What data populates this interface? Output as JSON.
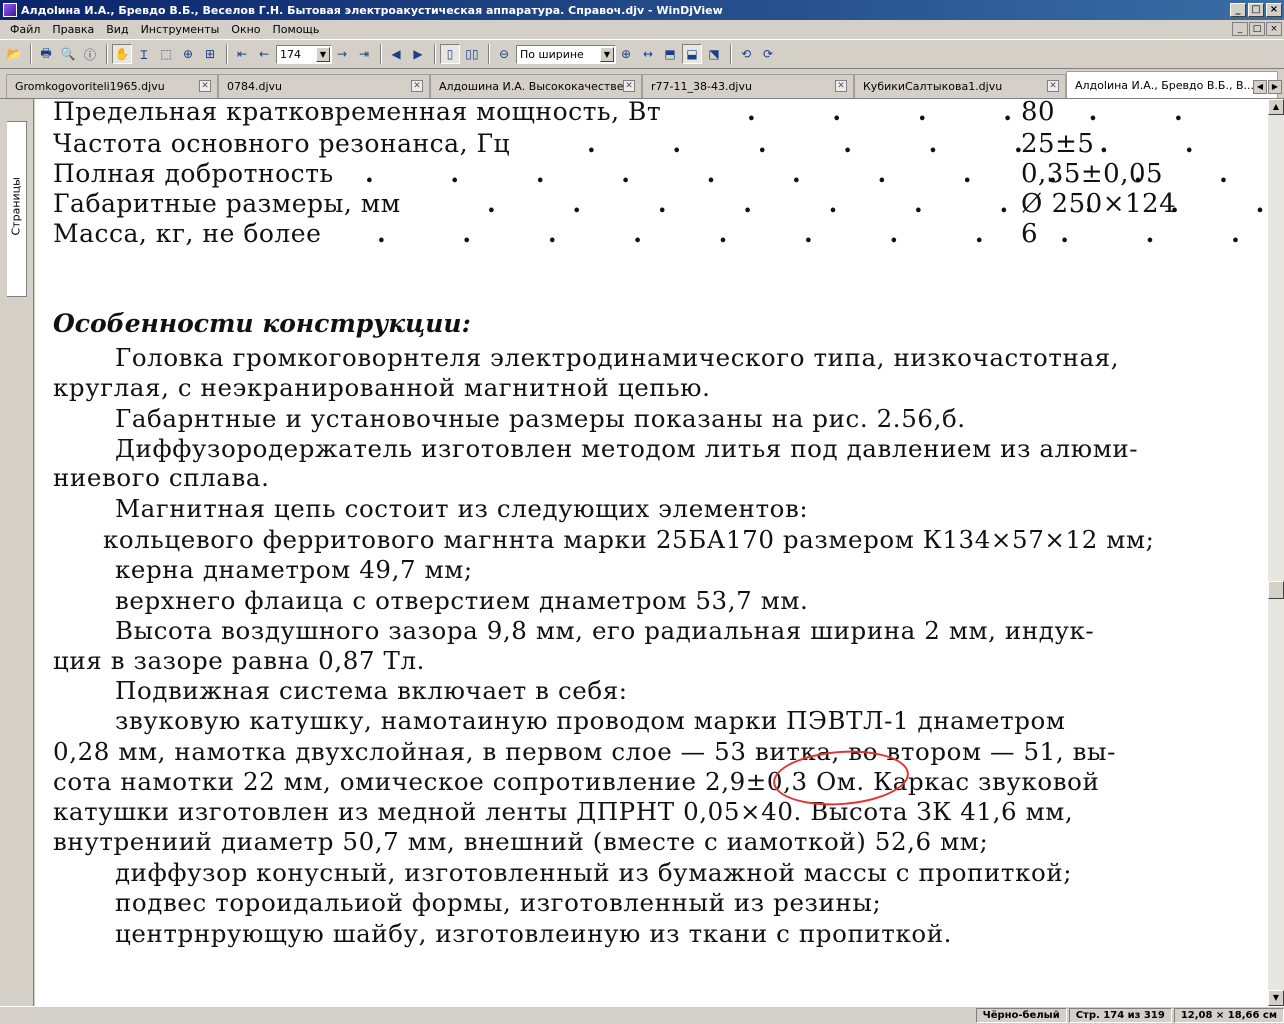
{
  "window": {
    "title": "Алдоlина И.А., Бревдо В.Б., Веселов Г.Н. Бытовая электроакустическая аппаратура. Справоч.djv - WinDjView",
    "controls": [
      "_",
      "□",
      "×"
    ]
  },
  "menu": {
    "items": [
      "Файл",
      "Правка",
      "Вид",
      "Инструменты",
      "Окно",
      "Помощь"
    ],
    "right_controls": [
      "_",
      "□",
      "×"
    ]
  },
  "toolbar": {
    "page_number": "174",
    "zoom_mode": "По ширине"
  },
  "tabs": [
    {
      "label": "Gromkogovoriteli1965.djvu",
      "active": false
    },
    {
      "label": "0784.djvu",
      "active": false
    },
    {
      "label": "Алдошина И.А. Высококачестве...",
      "active": false
    },
    {
      "label": "r77-11_38-43.djvu",
      "active": false
    },
    {
      "label": "КубикиСалтыкова1.djvu",
      "active": false
    },
    {
      "label": "Алдоlина И.А., Бревдо В.Б., В...",
      "active": true
    }
  ],
  "sidepanel": {
    "tab_label": "Страницы"
  },
  "document": {
    "specs": [
      {
        "label": "Предельная кратковременная мощность, Вт",
        "dots": ". . . . . .",
        "value": "80"
      },
      {
        "label": "Частота основного резонанса, Гц",
        "dots": ". . . . . . . . .",
        "value": "25±5"
      },
      {
        "label": "Полная добротность",
        "dots": ". . . . . . . . . . . . .",
        "value": "0,35±0,05"
      },
      {
        "label": "Габаритные размеры, мм",
        "dots": ". . . . . . . . . . .",
        "value": "Ø 250×124"
      },
      {
        "label": "Масса, кг, не более",
        "dots": ". . . . . . . . . . . . . .",
        "value": "6"
      }
    ],
    "heading": "Особенности конструкции:",
    "lines": [
      "Головка громкоговорнтеля электродинамического типа, низкочастотная,",
      "круглая, с неэкранированной магнитной цепью.",
      "Габарнтные и установочные размеры показаны на рис. 2.56,б.",
      "Диффузородержатель изготовлен методом литья под давлением из алюми-",
      "ниевого сплава.",
      "Магнитная цепь состоит из следующих элементов:",
      "кольцевого ферритового магннта марки 25БА170 размером К134×57×12 мм;",
      "керна днаметром 49,7 мм;",
      "верхнего флаица с отверстием днаметром 53,7 мм.",
      "Высота воздушного зазора 9,8 мм, его радиальная ширина 2 мм, индук-",
      "ция в зазоре равна 0,87 Тл.",
      "Подвижная система включает в себя:",
      "звуковую катушку, намотаиную проводом марки ПЭВТЛ-1 днаметром",
      "0,28 мм, намотка двухслойная, в первом слое — 53 витка, во втором — 51, вы-",
      "сота намотки 22 мм, омическое сопротивление  2,9±0,3  Ом. Каркас звуковой",
      "катушки изготовлен из медной ленты ДПРНТ 0,05×40.  Высота ЗК 41,6 мм,",
      "внутрениий диаметр 50,7 мм, внешний (вместе с иамоткой) 52,6 мм;",
      "диффузор конусный, изготовленный из бумажной массы с пропиткой;",
      "подвес тороидальиой формы, изготовленный из резины;",
      "центрнрующую шайбу, изготовлеиную из ткани с пропиткой."
    ],
    "annotation_color": "#e33333"
  },
  "status": {
    "mode": "Чёрно-белый",
    "page": "Стр. 174 из 319",
    "size": "12,08 × 18,66 см"
  }
}
